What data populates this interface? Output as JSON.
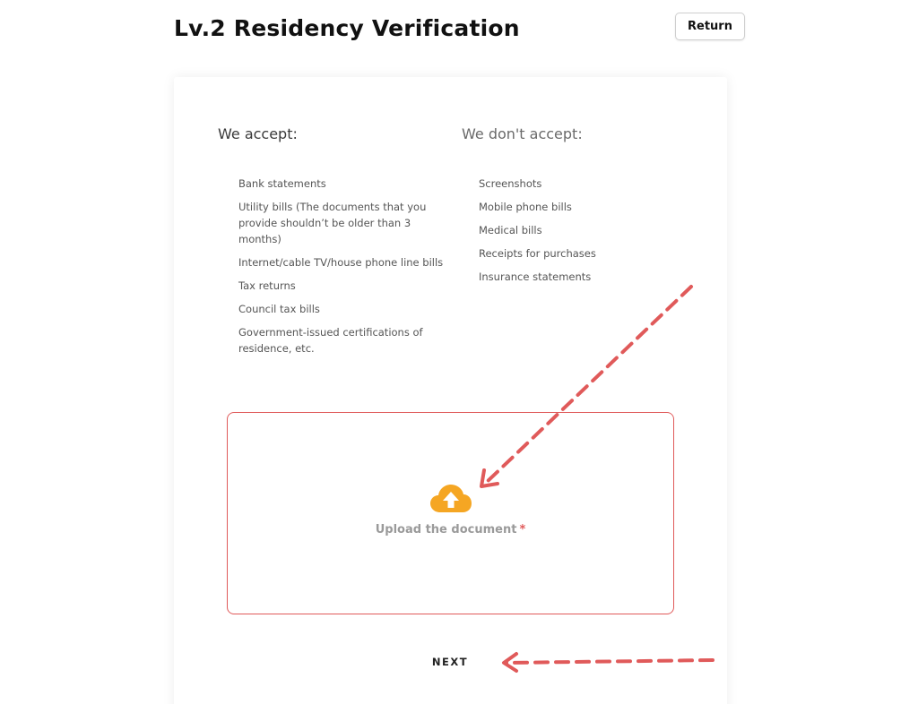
{
  "header": {
    "title": "Lv.2 Residency Verification",
    "return_label": "Return"
  },
  "accept": {
    "heading": "We accept:",
    "items": [
      "Bank statements",
      "Utility bills (The documents that you provide shouldn’t be older than 3 months)",
      "Internet/cable TV/house phone line bills",
      "Tax returns",
      "Council tax bills",
      "Government-issued certifications of residence, etc."
    ]
  },
  "reject": {
    "heading": "We don't accept:",
    "items": [
      "Screenshots",
      "Mobile phone bills",
      "Medical bills",
      "Receipts for purchases",
      "Insurance statements"
    ]
  },
  "upload": {
    "label": "Upload the document",
    "required_mark": "*",
    "icon": "cloud-upload-icon"
  },
  "footer": {
    "next_label": "NEXT"
  },
  "colors": {
    "accent": "#f5a623",
    "annotation": "#e05a5a",
    "required": "#e05a5a"
  }
}
